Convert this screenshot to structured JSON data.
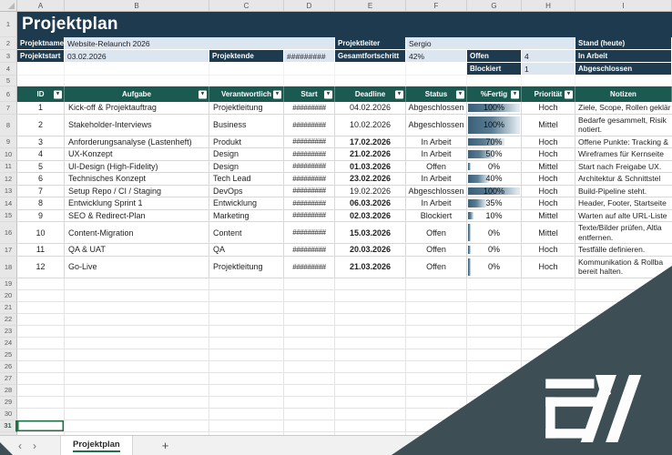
{
  "window": {
    "column_letters": [
      "A",
      "B",
      "C",
      "D",
      "E",
      "F",
      "G",
      "H",
      "I"
    ],
    "first_empty_row": 19,
    "last_row": 32
  },
  "title": "Projektplan",
  "info": {
    "rows": [
      {
        "row": 2,
        "cells": [
          {
            "col": 0,
            "span": 1,
            "kind": "label",
            "name": "projektname-label",
            "text": "Projektname"
          },
          {
            "col": 1,
            "span": 3,
            "kind": "value",
            "name": "projektname-value",
            "text": "Website-Relaunch 2026"
          },
          {
            "col": 4,
            "span": 1,
            "kind": "label",
            "name": "projektleiter-label",
            "text": "Projektleiter"
          },
          {
            "col": 5,
            "span": 3,
            "kind": "value",
            "name": "projektleiter-value",
            "text": "Sergio"
          },
          {
            "col": 8,
            "span": 1,
            "kind": "label",
            "name": "stand-heute-label",
            "text": "Stand (heute)"
          }
        ]
      },
      {
        "row": 3,
        "cells": [
          {
            "col": 0,
            "span": 1,
            "kind": "label",
            "name": "projektstart-label",
            "text": "Projektstart"
          },
          {
            "col": 1,
            "span": 1,
            "kind": "value",
            "name": "projektstart-value",
            "text": "03.02.2026"
          },
          {
            "col": 2,
            "span": 1,
            "kind": "label",
            "name": "projektende-label",
            "text": "Projektende"
          },
          {
            "col": 3,
            "span": 1,
            "kind": "value",
            "name": "projektende-value",
            "text": "#########"
          },
          {
            "col": 4,
            "span": 1,
            "kind": "label",
            "name": "gesamtfortschritt-label",
            "text": "Gesamtfortschritt"
          },
          {
            "col": 5,
            "span": 1,
            "kind": "value",
            "name": "gesamtfortschritt-value",
            "text": "42%"
          },
          {
            "col": 6,
            "span": 1,
            "kind": "label",
            "name": "offen-label",
            "text": "Offen"
          },
          {
            "col": 7,
            "span": 1,
            "kind": "value",
            "name": "offen-value",
            "text": "4"
          },
          {
            "col": 8,
            "span": 1,
            "kind": "label",
            "name": "in-arbeit-label",
            "text": "In Arbeit"
          }
        ]
      },
      {
        "row": 4,
        "cells": [
          {
            "col": 0,
            "span": 1,
            "kind": "empty",
            "name": "empty-cell",
            "text": ""
          },
          {
            "col": 1,
            "span": 1,
            "kind": "empty",
            "name": "empty-cell",
            "text": ""
          },
          {
            "col": 2,
            "span": 1,
            "kind": "empty",
            "name": "empty-cell",
            "text": ""
          },
          {
            "col": 3,
            "span": 1,
            "kind": "empty",
            "name": "empty-cell",
            "text": ""
          },
          {
            "col": 4,
            "span": 1,
            "kind": "empty",
            "name": "empty-cell",
            "text": ""
          },
          {
            "col": 5,
            "span": 1,
            "kind": "empty",
            "name": "empty-cell",
            "text": ""
          },
          {
            "col": 6,
            "span": 1,
            "kind": "label",
            "name": "blockiert-label",
            "text": "Blockiert"
          },
          {
            "col": 7,
            "span": 1,
            "kind": "value",
            "name": "blockiert-value",
            "text": "1"
          },
          {
            "col": 8,
            "span": 1,
            "kind": "label",
            "name": "abgeschlossen-label",
            "text": "Abgeschlossen"
          }
        ]
      }
    ]
  },
  "table": {
    "headers": [
      {
        "text": "ID",
        "filter": true
      },
      {
        "text": "Aufgabe",
        "filter": true
      },
      {
        "text": "Verantwortlich",
        "filter": true
      },
      {
        "text": "Start",
        "filter": true
      },
      {
        "text": "Deadline",
        "filter": true
      },
      {
        "text": "Status",
        "filter": true
      },
      {
        "text": "%Fertig",
        "filter": true
      },
      {
        "text": "Priorität",
        "filter": true
      },
      {
        "text": "Notizen",
        "filter": false
      }
    ],
    "rows": [
      {
        "id": "1",
        "aufgabe": "Kick-off & Projektauftrag",
        "verantwortlich": "Projektleitung",
        "start": "#########",
        "deadline": "04.02.2026",
        "deadline_bold": false,
        "status": "Abgeschlossen",
        "fertig_pct": 100,
        "fertig_label": "100%",
        "prioritaet": "Hoch",
        "notizen": [
          "Ziele, Scope, Rollen geklär"
        ]
      },
      {
        "id": "2",
        "aufgabe": "Stakeholder-Interviews",
        "verantwortlich": "Business",
        "start": "#########",
        "deadline": "10.02.2026",
        "deadline_bold": false,
        "status": "Abgeschlossen",
        "fertig_pct": 100,
        "fertig_label": "100%",
        "prioritaet": "Mittel",
        "notizen": [
          "Bedarfe gesammelt, Risik",
          "notiert."
        ]
      },
      {
        "id": "3",
        "aufgabe": "Anforderungsanalyse (Lastenheft)",
        "verantwortlich": "Produkt",
        "start": "#########",
        "deadline": "17.02.2026",
        "deadline_bold": true,
        "status": "In Arbeit",
        "fertig_pct": 70,
        "fertig_label": "70%",
        "prioritaet": "Hoch",
        "notizen": [
          "Offene Punkte: Tracking &"
        ]
      },
      {
        "id": "4",
        "aufgabe": "UX-Konzept",
        "verantwortlich": "Design",
        "start": "#########",
        "deadline": "21.02.2026",
        "deadline_bold": true,
        "status": "In Arbeit",
        "fertig_pct": 50,
        "fertig_label": "50%",
        "prioritaet": "Hoch",
        "notizen": [
          "Wireframes für Kernseite"
        ]
      },
      {
        "id": "5",
        "aufgabe": "UI-Design (High-Fidelity)",
        "verantwortlich": "Design",
        "start": "#########",
        "deadline": "01.03.2026",
        "deadline_bold": true,
        "status": "Offen",
        "fertig_pct": 0,
        "fertig_label": "0%",
        "prioritaet": "Mittel",
        "notizen": [
          "Start nach Freigabe UX."
        ]
      },
      {
        "id": "6",
        "aufgabe": "Technisches Konzept",
        "verantwortlich": "Tech Lead",
        "start": "#########",
        "deadline": "23.02.2026",
        "deadline_bold": true,
        "status": "In Arbeit",
        "fertig_pct": 40,
        "fertig_label": "40%",
        "prioritaet": "Hoch",
        "notizen": [
          "Architektur & Schnittstel"
        ]
      },
      {
        "id": "7",
        "aufgabe": "Setup Repo / CI / Staging",
        "verantwortlich": "DevOps",
        "start": "#########",
        "deadline": "19.02.2026",
        "deadline_bold": false,
        "status": "Abgeschlossen",
        "fertig_pct": 100,
        "fertig_label": "100%",
        "prioritaet": "Hoch",
        "notizen": [
          "Build-Pipeline steht."
        ]
      },
      {
        "id": "8",
        "aufgabe": "Entwicklung Sprint 1",
        "verantwortlich": "Entwicklung",
        "start": "#########",
        "deadline": "06.03.2026",
        "deadline_bold": true,
        "status": "In Arbeit",
        "fertig_pct": 35,
        "fertig_label": "35%",
        "prioritaet": "Hoch",
        "notizen": [
          "Header, Footer, Startseite"
        ]
      },
      {
        "id": "9",
        "aufgabe": "SEO & Redirect-Plan",
        "verantwortlich": "Marketing",
        "start": "#########",
        "deadline": "02.03.2026",
        "deadline_bold": true,
        "status": "Blockiert",
        "fertig_pct": 10,
        "fertig_label": "10%",
        "prioritaet": "Mittel",
        "notizen": [
          "Warten auf alte URL-Liste"
        ]
      },
      {
        "id": "10",
        "aufgabe": "Content-Migration",
        "verantwortlich": "Content",
        "start": "#########",
        "deadline": "15.03.2026",
        "deadline_bold": true,
        "status": "Offen",
        "fertig_pct": 0,
        "fertig_label": "0%",
        "prioritaet": "Mittel",
        "notizen": [
          "Texte/Bilder prüfen, Altla",
          "entfernen."
        ]
      },
      {
        "id": "11",
        "aufgabe": "QA & UAT",
        "verantwortlich": "QA",
        "start": "#########",
        "deadline": "20.03.2026",
        "deadline_bold": true,
        "status": "Offen",
        "fertig_pct": 0,
        "fertig_label": "0%",
        "prioritaet": "Hoch",
        "notizen": [
          "Testfälle definieren."
        ]
      },
      {
        "id": "12",
        "aufgabe": "Go-Live",
        "verantwortlich": "Projektleitung",
        "start": "#########",
        "deadline": "21.03.2026",
        "deadline_bold": true,
        "status": "Offen",
        "fertig_pct": 0,
        "fertig_label": "0%",
        "prioritaet": "Hoch",
        "notizen": [
          "Kommunikation & Rollba",
          "bereit halten."
        ]
      }
    ]
  },
  "selection": {
    "active_row": 31,
    "active_col": 0
  },
  "sheet_bar": {
    "prev": "‹",
    "next": "›",
    "active_tab": "Projektplan",
    "add": "+"
  },
  "brand": {
    "logo_text": "EW"
  },
  "colors": {
    "navy": "#1e3a4e",
    "teal": "#1b5a51",
    "lightblue": "#dce6f1",
    "green": "#1e7145",
    "bar": "#3a5f77",
    "overlay": "#3d4e54"
  }
}
